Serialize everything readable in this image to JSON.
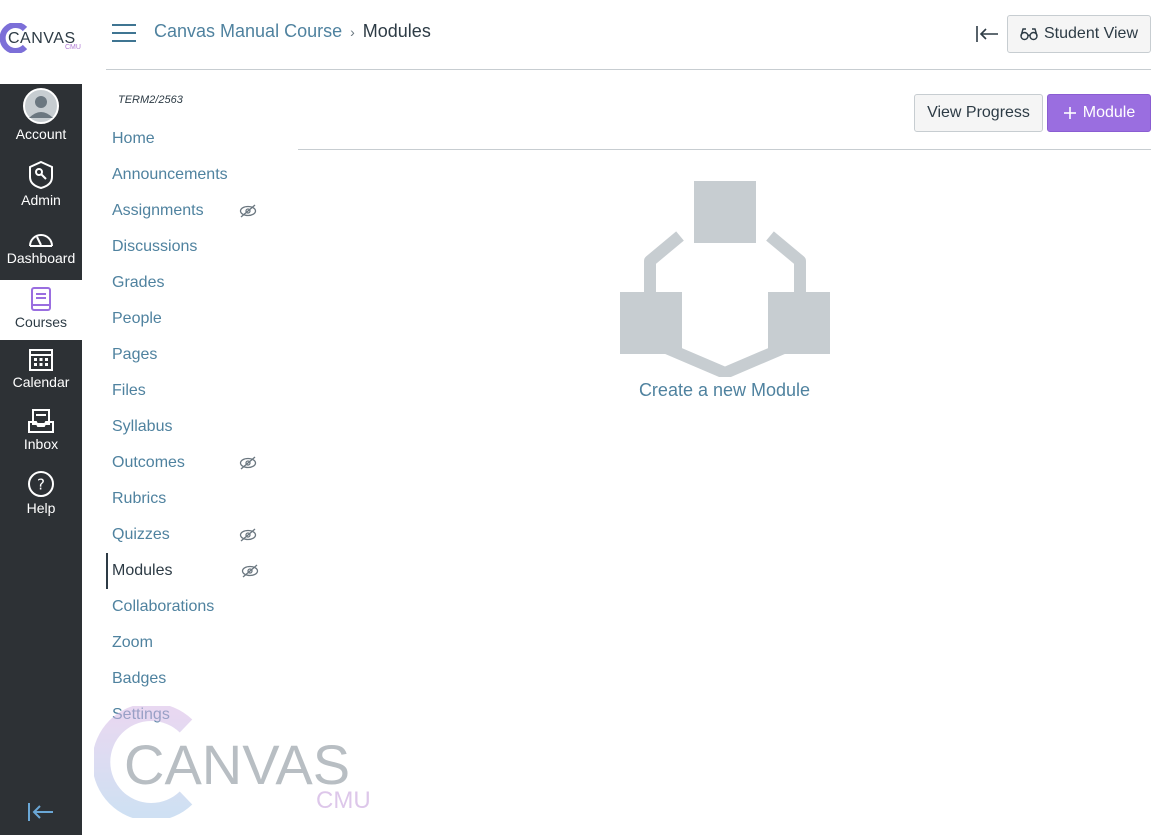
{
  "logo": {
    "text": "CANVAS",
    "sub": "CMU"
  },
  "global_nav": [
    {
      "label": "Account",
      "icon": "avatar-icon"
    },
    {
      "label": "Admin",
      "icon": "admin-shield-icon"
    },
    {
      "label": "Dashboard",
      "icon": "dashboard-gauge-icon"
    },
    {
      "label": "Courses",
      "icon": "book-icon"
    },
    {
      "label": "Calendar",
      "icon": "calendar-icon"
    },
    {
      "label": "Inbox",
      "icon": "inbox-icon"
    },
    {
      "label": "Help",
      "icon": "help-icon"
    }
  ],
  "header": {
    "breadcrumb_course": "Canvas Manual Course",
    "breadcrumb_sep": "›",
    "breadcrumb_current": "Modules",
    "student_view": "Student View"
  },
  "course_nav": {
    "term": "TERM2/2563",
    "items": [
      {
        "label": "Home",
        "hidden": false
      },
      {
        "label": "Announcements",
        "hidden": false
      },
      {
        "label": "Assignments",
        "hidden": true
      },
      {
        "label": "Discussions",
        "hidden": false
      },
      {
        "label": "Grades",
        "hidden": false
      },
      {
        "label": "People",
        "hidden": false
      },
      {
        "label": "Pages",
        "hidden": false
      },
      {
        "label": "Files",
        "hidden": false
      },
      {
        "label": "Syllabus",
        "hidden": false
      },
      {
        "label": "Outcomes",
        "hidden": true
      },
      {
        "label": "Rubrics",
        "hidden": false
      },
      {
        "label": "Quizzes",
        "hidden": true
      },
      {
        "label": "Modules",
        "hidden": true,
        "active": true
      },
      {
        "label": "Collaborations",
        "hidden": false
      },
      {
        "label": "Zoom",
        "hidden": false
      },
      {
        "label": "Badges",
        "hidden": false
      },
      {
        "label": "Settings",
        "hidden": false
      }
    ]
  },
  "toolbar": {
    "view_progress": "View Progress",
    "add_module": "Module"
  },
  "empty_state": {
    "create_link": "Create a new Module"
  },
  "watermark": {
    "text": "CANVAS",
    "sub": "CMU"
  },
  "colors": {
    "nav_dark": "#2d3135",
    "link": "#4f829f",
    "accent_purple": "#9a6ee0",
    "illustration": "#c7cdd1"
  }
}
